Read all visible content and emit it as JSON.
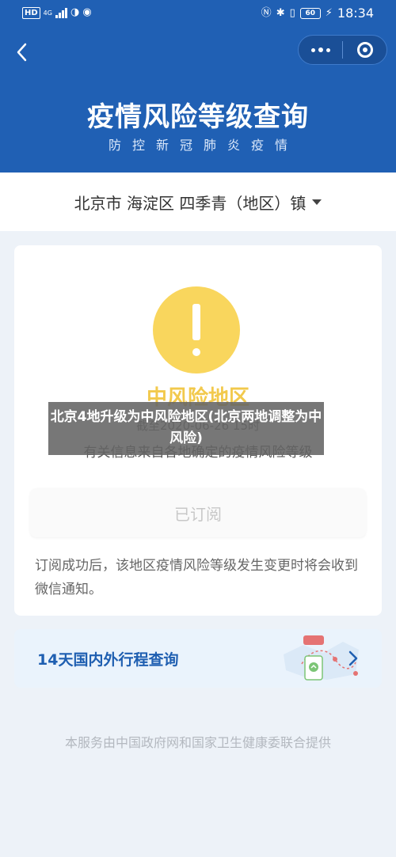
{
  "status_bar": {
    "hd": "HD",
    "network": "4G",
    "battery": "60",
    "time": "18:34"
  },
  "header": {
    "title": "疫情风险等级查询",
    "subtitle": "防控新冠肺炎疫情"
  },
  "location": {
    "text": "北京市 海淀区 四季青（地区）镇"
  },
  "risk_card": {
    "level": "中风险地区",
    "as_of": "截至2020-06-26 15时",
    "source_note": "有关信息来自各地确定的疫情风险等级",
    "subscribe_label": "已订阅",
    "subscribe_desc": "订阅成功后，该地区疫情风险等级发生变更时将会收到微信通知。"
  },
  "travel_card": {
    "label": "14天国内外行程查询"
  },
  "footer": {
    "note": "本服务由中国政府网和国家卫生健康委联合提供"
  },
  "overlay": {
    "caption": "北京4地升级为中风险地区(北京两地调整为中风险)"
  },
  "colors": {
    "header_bg": "#2060b4",
    "warning_yellow": "#f9d65d",
    "travel_text": "#1f5fb1"
  }
}
